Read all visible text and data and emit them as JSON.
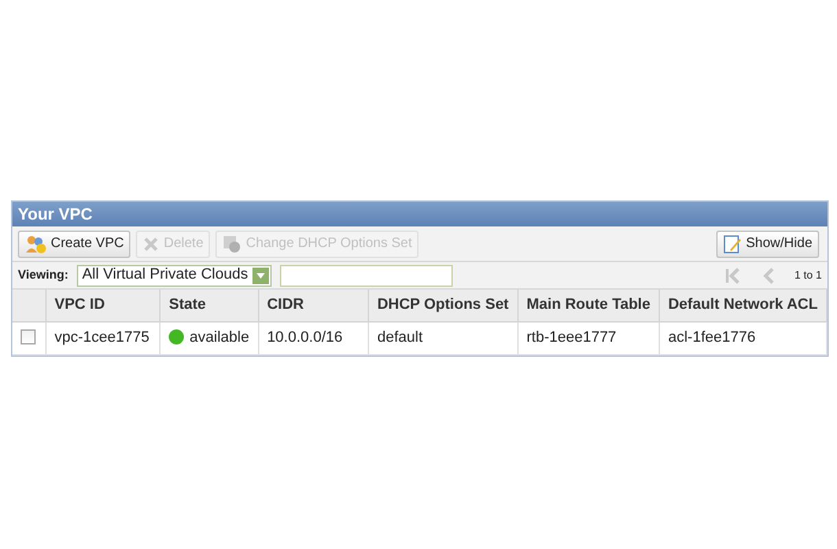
{
  "panel": {
    "title": "Your VPC"
  },
  "toolbar": {
    "buttons": [
      {
        "label": "Create VPC",
        "kind": "create",
        "disabled": false
      },
      {
        "label": "Delete",
        "kind": "delete",
        "disabled": true
      },
      {
        "label": "Change DHCP Options Set",
        "kind": "dhcp",
        "disabled": true
      }
    ],
    "show_hide": "Show/Hide"
  },
  "filter": {
    "label": "Viewing:",
    "value": "All Virtual Private Clouds"
  },
  "pagination": {
    "first_disabled": true,
    "prev_disabled": true,
    "range": "1 to 1"
  },
  "table": {
    "columns": [
      "VPC ID",
      "State",
      "CIDR",
      "DHCP Options Set",
      "Main Route Table",
      "Default Network ACL"
    ],
    "rows": [
      {
        "selected": false,
        "vpc_id": "vpc-1cee1775",
        "state": {
          "label": "available",
          "color": "#44b824"
        },
        "cidr": "10.0.0.0/16",
        "dhcp": "default",
        "route_table": "rtb-1eee1777",
        "acl": "acl-1fee1776"
      }
    ]
  }
}
